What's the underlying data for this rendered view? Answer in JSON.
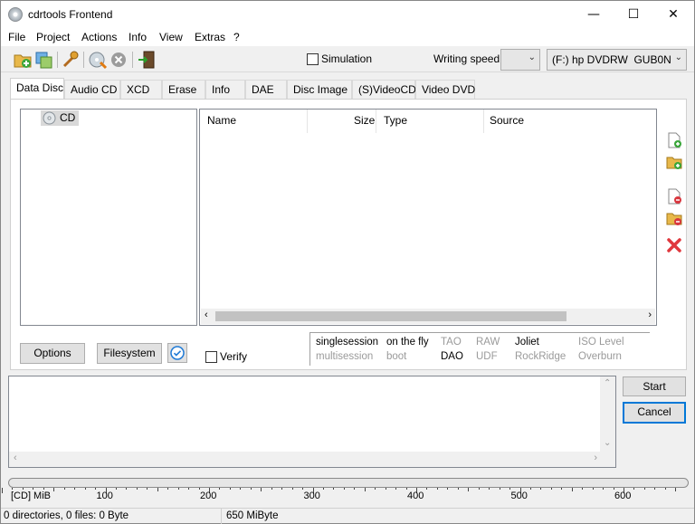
{
  "window": {
    "title": "cdrtools Frontend"
  },
  "window_controls": {
    "minimize": "—",
    "maximize": "☐",
    "close": "✕"
  },
  "menu": [
    "File",
    "Project",
    "Actions",
    "Info",
    "View",
    "Extras",
    "?"
  ],
  "toolbar": {
    "simulation_label": "Simulation",
    "simulation_checked": false,
    "writing_speed_label": "Writing speed",
    "writing_speed_value": "",
    "drive_value": "(F:) hp DVDRW  GUB0N",
    "icons": [
      "add-folder-icon",
      "copy-icon",
      "tools-icon",
      "burn-icon",
      "cancel-icon",
      "exit-icon"
    ]
  },
  "tabs": [
    "Data Disc",
    "Audio CD",
    "XCD",
    "Erase",
    "Info",
    "DAE",
    "Disc Image",
    "(S)VideoCD",
    "Video DVD"
  ],
  "active_tab": "Data Disc",
  "tree": {
    "root_label": "CD"
  },
  "file_list": {
    "columns": [
      "Name",
      "Size",
      "Type",
      "Source"
    ],
    "rows": []
  },
  "side_actions": [
    "add-file-icon",
    "add-folder-icon",
    "remove-file-icon",
    "remove-folder-icon",
    "delete-all-icon"
  ],
  "buttons": {
    "options": "Options",
    "filesystem": "Filesystem",
    "start": "Start",
    "cancel": "Cancel"
  },
  "verify": {
    "label": "Verify",
    "checked": false
  },
  "write_options": {
    "row1": [
      {
        "text": "singlesession",
        "active": true
      },
      {
        "text": "on the fly",
        "active": true
      },
      {
        "text": "TAO",
        "active": false
      },
      {
        "text": "RAW",
        "active": false
      },
      {
        "text": "Joliet",
        "active": true
      },
      {
        "text": "ISO Level",
        "active": false
      }
    ],
    "row2": [
      {
        "text": "multisession",
        "active": false
      },
      {
        "text": "boot",
        "active": false
      },
      {
        "text": "DAO",
        "active": true
      },
      {
        "text": "UDF",
        "active": false
      },
      {
        "text": "RockRidge",
        "active": false
      },
      {
        "text": "Overburn",
        "active": false
      }
    ]
  },
  "ruler": {
    "unit_label": "[CD] MiB",
    "ticks": [
      "100",
      "200",
      "300",
      "400",
      "500",
      "600"
    ]
  },
  "status": {
    "left": "0 directories, 0 files: 0 Byte",
    "right": "650 MiByte"
  },
  "progress": {
    "fraction": 0
  }
}
